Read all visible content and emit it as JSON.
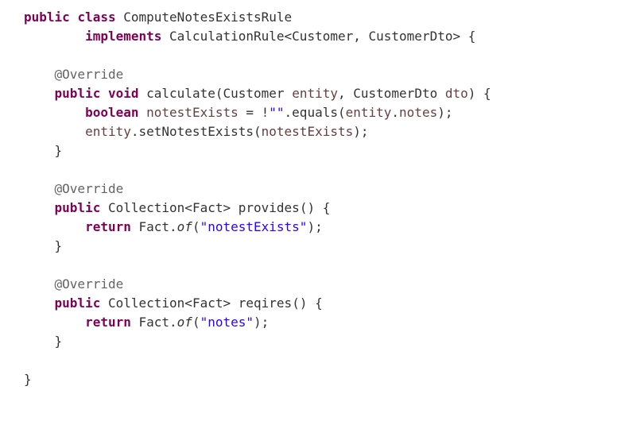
{
  "kw": {
    "public": "public",
    "class": "class",
    "implements": "implements",
    "void": "void",
    "boolean": "boolean",
    "return": "return"
  },
  "ann": {
    "override": "@Override"
  },
  "cls": {
    "ComputeNotesExistsRule": "ComputeNotesExistsRule",
    "CalculationRule": "CalculationRule",
    "Customer": "Customer",
    "CustomerDto": "CustomerDto",
    "Collection": "Collection",
    "Fact": "Fact"
  },
  "ident": {
    "entity": "entity",
    "dto": "dto",
    "notestExists": "notestExists",
    "notes": "notes"
  },
  "mth": {
    "calculate": "calculate",
    "equals": "equals",
    "setNotestExists": "setNotestExists",
    "provides": "provides",
    "reqires": "reqires",
    "of": "of"
  },
  "str": {
    "empty": "\"\"",
    "notestExists": "\"notestExists\"",
    "notes": "\"notes\""
  },
  "punct": {
    "lt": "<",
    "gt": ">",
    "comma_sp": ", ",
    "sp_obrace": " {",
    "cbrace": "}",
    "oparen": "(",
    "cparen": ")",
    "cparen_semi": ");",
    "cparen_sp_obrace": ") {",
    "sp": " ",
    "sp_eq_sp_bang": " = !",
    "dot": "."
  }
}
